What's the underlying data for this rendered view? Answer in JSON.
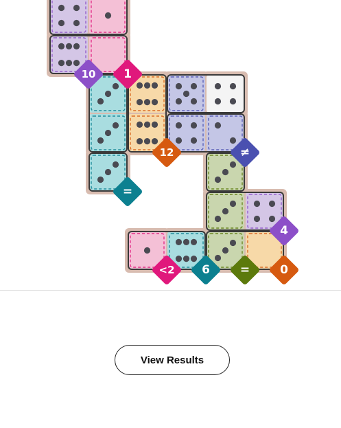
{
  "colors": {
    "tray": "#d8bcb0",
    "outline": "#3a3a3a",
    "pip": "#4a4a52",
    "purple": "#d4c6e6",
    "pink": "#f4c0d6",
    "cyan": "#a9dde0",
    "orange": "#f7d9a8",
    "periwinkle": "#c4c6e6",
    "white": "#f4f4f4",
    "green": "#c9d6ae",
    "badge_purple": "#8c4fc8",
    "badge_magenta": "#e0187c",
    "badge_orange": "#d65a10",
    "badge_indigo": "#4a50b0",
    "badge_teal": "#0c8090",
    "badge_green": "#5c7a0c"
  },
  "regions": [
    {
      "id": "r-purple-top",
      "color": "purple"
    },
    {
      "id": "r-pink-top",
      "color": "pink"
    },
    {
      "id": "r-cyan-left",
      "color": "cyan"
    },
    {
      "id": "r-orange-mid",
      "color": "orange"
    },
    {
      "id": "r-periwinkle",
      "color": "periwinkle"
    },
    {
      "id": "r-green",
      "color": "green"
    },
    {
      "id": "r-purple-right",
      "color": "purple"
    },
    {
      "id": "r-pink-bottom",
      "color": "pink"
    },
    {
      "id": "r-cyan-bottom",
      "color": "cyan"
    },
    {
      "id": "r-orange-bottom",
      "color": "orange"
    }
  ],
  "cells": [
    {
      "col": 0,
      "row": 0,
      "pips": 4,
      "color": "purple",
      "region": "r-purple-top"
    },
    {
      "col": 1,
      "row": 0,
      "pips": 1,
      "color": "pink",
      "region": "r-pink-top"
    },
    {
      "col": 0,
      "row": 1,
      "pips": 6,
      "color": "purple",
      "region": "r-purple-top"
    },
    {
      "col": 1,
      "row": 1,
      "pips": 0,
      "color": "pink",
      "region": "r-pink-top"
    },
    {
      "col": 1,
      "row": 2,
      "pips": 3,
      "color": "cyan",
      "region": "r-cyan-left"
    },
    {
      "col": 2,
      "row": 2,
      "pips": 6,
      "color": "orange",
      "region": "r-orange-mid"
    },
    {
      "col": 3,
      "row": 2,
      "pips": 5,
      "color": "periwinkle",
      "region": "r-periwinkle"
    },
    {
      "col": 4,
      "row": 2,
      "pips": 4,
      "color": "white",
      "region": ""
    },
    {
      "col": 1,
      "row": 3,
      "pips": 3,
      "color": "cyan",
      "region": "r-cyan-left"
    },
    {
      "col": 2,
      "row": 3,
      "pips": 6,
      "color": "orange",
      "region": "r-orange-mid"
    },
    {
      "col": 3,
      "row": 3,
      "pips": 4,
      "color": "periwinkle",
      "region": "r-periwinkle"
    },
    {
      "col": 4,
      "row": 3,
      "pips": 2,
      "color": "periwinkle",
      "region": "r-periwinkle"
    },
    {
      "col": 1,
      "row": 4,
      "pips": 3,
      "color": "cyan",
      "region": "r-cyan-left"
    },
    {
      "col": 4,
      "row": 4,
      "pips": 3,
      "color": "green",
      "region": "r-green"
    },
    {
      "col": 4,
      "row": 5,
      "pips": 3,
      "color": "green",
      "region": "r-green"
    },
    {
      "col": 5,
      "row": 5,
      "pips": 4,
      "color": "purple",
      "region": "r-purple-right"
    },
    {
      "col": 2,
      "row": 6,
      "pips": 1,
      "color": "pink",
      "region": "r-pink-bottom"
    },
    {
      "col": 3,
      "row": 6,
      "pips": 6,
      "color": "cyan",
      "region": "r-cyan-bottom"
    },
    {
      "col": 4,
      "row": 6,
      "pips": 3,
      "color": "green",
      "region": "r-green"
    },
    {
      "col": 5,
      "row": 6,
      "pips": 0,
      "color": "orange",
      "region": "r-orange-bottom"
    }
  ],
  "dominoes": [
    {
      "a": [
        0,
        0
      ],
      "b": [
        1,
        0
      ]
    },
    {
      "a": [
        0,
        1
      ],
      "b": [
        1,
        1
      ]
    },
    {
      "a": [
        1,
        2
      ],
      "b": [
        1,
        3
      ]
    },
    {
      "a": [
        2,
        2
      ],
      "b": [
        2,
        3
      ]
    },
    {
      "a": [
        3,
        2
      ],
      "b": [
        4,
        2
      ]
    },
    {
      "a": [
        3,
        3
      ],
      "b": [
        4,
        3
      ]
    },
    {
      "a": [
        1,
        4
      ],
      "b": [
        1,
        4
      ]
    },
    {
      "a": [
        4,
        4
      ],
      "b": [
        4,
        4
      ]
    },
    {
      "a": [
        4,
        5
      ],
      "b": [
        5,
        5
      ]
    },
    {
      "a": [
        2,
        6
      ],
      "b": [
        3,
        6
      ]
    },
    {
      "a": [
        4,
        6
      ],
      "b": [
        5,
        6
      ]
    }
  ],
  "constraints": [
    {
      "label": "10",
      "color": "badge_purple",
      "anchor": [
        1,
        2
      ],
      "corner": "tl"
    },
    {
      "label": "1",
      "color": "badge_magenta",
      "anchor": [
        2,
        2
      ],
      "corner": "tl"
    },
    {
      "label": "12",
      "color": "badge_orange",
      "anchor": [
        2,
        3
      ],
      "corner": "br"
    },
    {
      "label": "≠",
      "color": "badge_indigo",
      "anchor": [
        4,
        3
      ],
      "corner": "br"
    },
    {
      "label": "=",
      "color": "badge_teal",
      "anchor": [
        1,
        4
      ],
      "corner": "br"
    },
    {
      "label": "4",
      "color": "badge_purple",
      "anchor": [
        5,
        5
      ],
      "corner": "br"
    },
    {
      "label": "<2",
      "color": "badge_magenta",
      "anchor": [
        2,
        6
      ],
      "corner": "br"
    },
    {
      "label": "6",
      "color": "badge_teal",
      "anchor": [
        3,
        6
      ],
      "corner": "br"
    },
    {
      "label": "=",
      "color": "badge_green",
      "anchor": [
        4,
        6
      ],
      "corner": "br"
    },
    {
      "label": "0",
      "color": "badge_orange",
      "anchor": [
        5,
        6
      ],
      "corner": "br"
    }
  ],
  "actions": {
    "view_results_label": "View Results"
  }
}
